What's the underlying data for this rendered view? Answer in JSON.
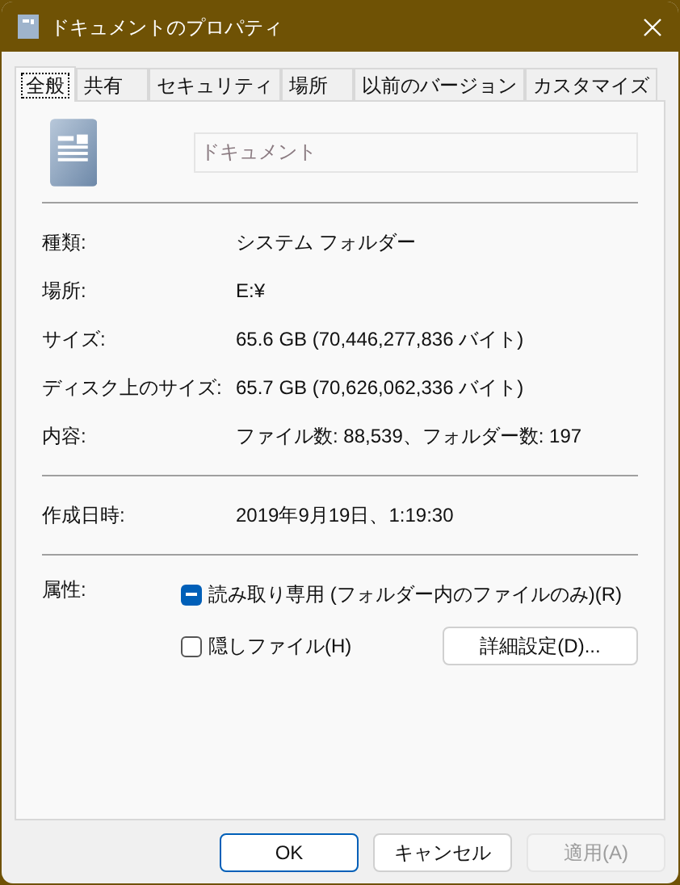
{
  "window": {
    "title": "ドキュメントのプロパティ"
  },
  "tabs": [
    {
      "label": "全般",
      "selected": true
    },
    {
      "label": "共有",
      "selected": false
    },
    {
      "label": "セキュリティ",
      "selected": false
    },
    {
      "label": "場所",
      "selected": false
    },
    {
      "label": "以前のバージョン",
      "selected": false
    },
    {
      "label": "カスタマイズ",
      "selected": false
    }
  ],
  "name_field": {
    "placeholder": "ドキュメント"
  },
  "info_groups": [
    [
      {
        "label": "種類:",
        "value": "システム フォルダー"
      },
      {
        "label": "場所:",
        "value": "E:¥"
      },
      {
        "label": "サイズ:",
        "value": "65.6 GB (70,446,277,836 バイト)"
      },
      {
        "label": "ディスク上のサイズ:",
        "value": "65.7 GB (70,626,062,336 バイト)"
      },
      {
        "label": "内容:",
        "value": "ファイル数: 88,539、フォルダー数: 197"
      }
    ],
    [
      {
        "label": "作成日時:",
        "value": "2019年9月19日、1:19:30"
      }
    ]
  ],
  "attributes": {
    "label": "属性:",
    "options": [
      {
        "label": "読み取り専用 (フォルダー内のファイルのみ)(R)",
        "indeterminate": true
      },
      {
        "label": "隠しファイル(H)",
        "checked": false,
        "indeterminate": false
      }
    ],
    "advanced_button": "詳細設定(D)..."
  },
  "buttons": [
    {
      "label": "OK",
      "default": true,
      "disabled": false
    },
    {
      "label": "キャンセル",
      "default": false,
      "disabled": false
    },
    {
      "label": "適用(A)",
      "default": false,
      "disabled": true
    }
  ]
}
